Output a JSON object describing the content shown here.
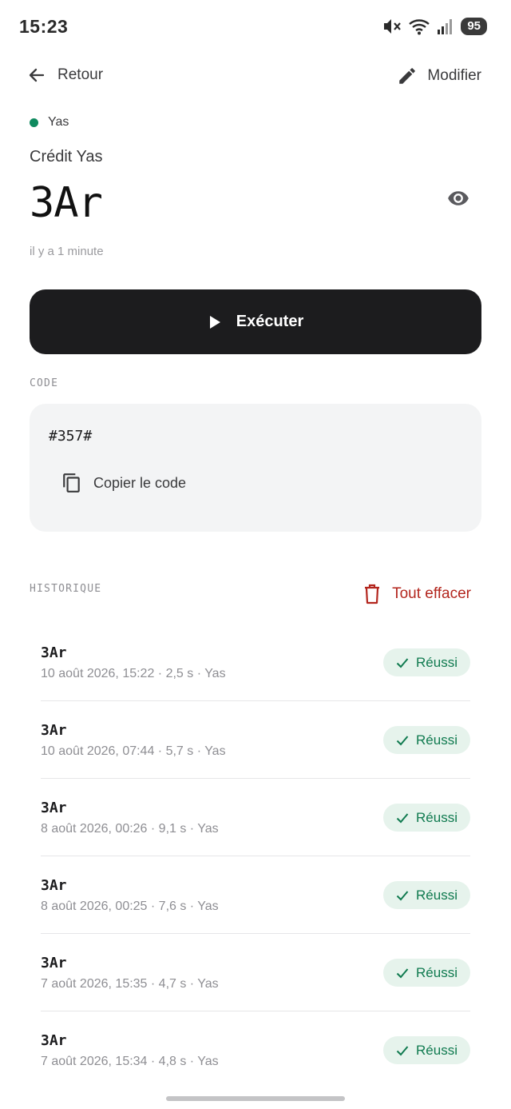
{
  "status": {
    "time": "15:23",
    "battery": "95",
    "icons": [
      "mute-icon",
      "wifi-icon",
      "signal-icon"
    ]
  },
  "topbar": {
    "back_label": "Retour",
    "edit_label": "Modifier"
  },
  "operator": {
    "name": "Yas",
    "color": "#0f8a5f"
  },
  "credit": {
    "title": "Crédit Yas",
    "balance": "3Ar",
    "updated": "il y a 1 minute"
  },
  "run": {
    "label": "Exécuter"
  },
  "code": {
    "section_label": "CODE",
    "value": "#357#",
    "copy_label": "Copier le code"
  },
  "history": {
    "section_label": "HISTORIQUE",
    "clear_label": "Tout effacer",
    "items": [
      {
        "amount": "3Ar",
        "meta": "10 août 2026, 15:22 · 2,5 s · Yas",
        "status": "Réussi"
      },
      {
        "amount": "3Ar",
        "meta": "10 août 2026, 07:44 · 5,7 s · Yas",
        "status": "Réussi"
      },
      {
        "amount": "3Ar",
        "meta": "8 août 2026, 00:26 · 9,1 s · Yas",
        "status": "Réussi"
      },
      {
        "amount": "3Ar",
        "meta": "8 août 2026, 00:25 · 7,6 s · Yas",
        "status": "Réussi"
      },
      {
        "amount": "3Ar",
        "meta": "7 août 2026, 15:35 · 4,7 s · Yas",
        "status": "Réussi"
      },
      {
        "amount": "3Ar",
        "meta": "7 août 2026, 15:34 · 4,8 s · Yas",
        "status": "Réussi"
      }
    ]
  },
  "colors": {
    "accent_dark": "#1c1c1e",
    "success_bg": "#e6f3ec",
    "success_text": "#0f7a4f",
    "danger": "#b3261e"
  }
}
